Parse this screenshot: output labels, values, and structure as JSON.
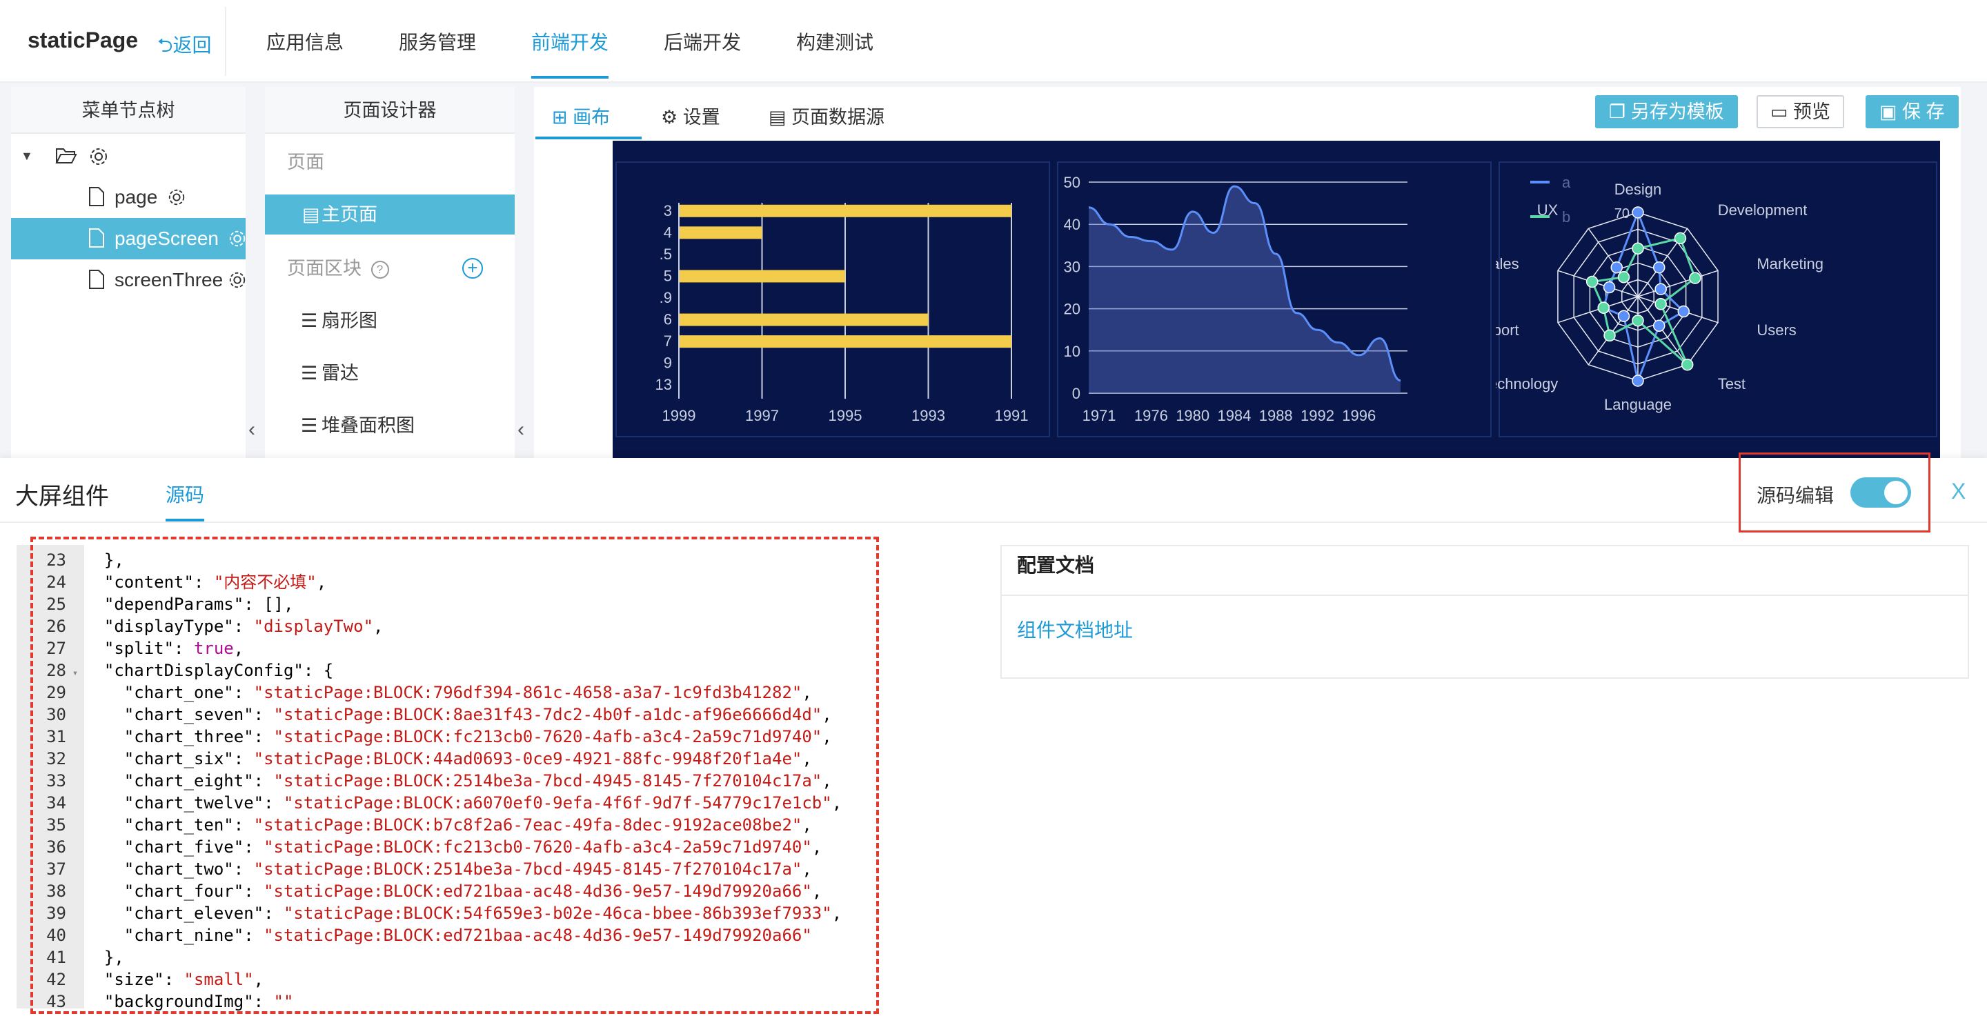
{
  "app": {
    "brand": "staticPage",
    "back_label": "返回"
  },
  "nav": {
    "tabs": [
      "应用信息",
      "服务管理",
      "前端开发",
      "后端开发",
      "构建测试"
    ],
    "active_index": 2
  },
  "menu_tree": {
    "title": "菜单节点树",
    "items": [
      {
        "label": "page"
      },
      {
        "label": "pageScreen",
        "selected": true
      },
      {
        "label": "screenThree"
      }
    ]
  },
  "designer": {
    "title": "页面设计器",
    "page_group": "页面",
    "main_page": "主页面",
    "blocks_group": "页面区块",
    "blocks": [
      "扇形图",
      "雷达",
      "堆叠面积图"
    ]
  },
  "canvas": {
    "tabs": [
      "画布",
      "设置",
      "页面数据源"
    ],
    "buttons": {
      "save_template": "另存为模板",
      "preview": "预览",
      "save": "保 存"
    }
  },
  "chart_data": [
    {
      "type": "bar",
      "orientation": "horizontal",
      "categories": [
        "3",
        "4",
        ".5",
        "5",
        ".9",
        "6",
        "7",
        "9",
        "13"
      ],
      "values": [
        1991.0,
        1997.0,
        null,
        1995.0,
        null,
        1993.0,
        1991.0,
        1999.0,
        null
      ],
      "x_ticks": [
        "1999",
        "1997",
        "1995",
        "1993",
        "1991"
      ],
      "color": "#f2cc4a"
    },
    {
      "type": "area",
      "x_ticks": [
        "1971",
        "1976",
        "1980",
        "1984",
        "1988",
        "1992",
        "1996"
      ],
      "y_ticks": [
        0,
        10,
        20,
        30,
        40,
        50
      ],
      "ylim": [
        0,
        50
      ],
      "x": [
        1970,
        1972,
        1974,
        1976,
        1978,
        1980,
        1982,
        1984,
        1986,
        1988,
        1990,
        1992,
        1994,
        1996,
        1998,
        2000
      ],
      "values": [
        44,
        40,
        37,
        36,
        34,
        43,
        38,
        49,
        45,
        33,
        19,
        15,
        12,
        9,
        13,
        3
      ],
      "color": "#5b8ff9"
    },
    {
      "type": "radar",
      "legend": [
        "a",
        "b"
      ],
      "axes": [
        "Design",
        "Development",
        "Marketing",
        "Users",
        "Test",
        "Language",
        "Technology",
        "Support",
        "Sales",
        "UX"
      ],
      "radial_tick": "70",
      "series": [
        {
          "name": "a",
          "values": [
            70,
            30,
            20,
            40,
            30,
            70,
            20,
            30,
            25,
            30
          ]
        },
        {
          "name": "b",
          "values": [
            40,
            60,
            50,
            20,
            70,
            20,
            40,
            30,
            40,
            20
          ]
        }
      ],
      "colors": [
        "#5b8ff9",
        "#5ad8a6"
      ]
    }
  ],
  "drawer": {
    "title": "大屏组件",
    "tab": "源码",
    "toggle_label": "源码编辑",
    "toggle_on": true,
    "close": "X"
  },
  "code": {
    "lines": [
      {
        "n": "23",
        "text": "  },",
        "fold": false
      },
      {
        "n": "24",
        "key": "\"content\"",
        "val": "\"内容不必填\"",
        "vtype": "s",
        "tail": ",",
        "indent": "  "
      },
      {
        "n": "25",
        "key": "\"dependParams\"",
        "val": "[]",
        "vtype": "p",
        "tail": ",",
        "indent": "  "
      },
      {
        "n": "26",
        "key": "\"displayType\"",
        "val": "\"displayTwo\"",
        "vtype": "s",
        "tail": ",",
        "indent": "  "
      },
      {
        "n": "27",
        "key": "\"split\"",
        "val": "true",
        "vtype": "b",
        "tail": ",",
        "indent": "  "
      },
      {
        "n": "28",
        "key": "\"chartDisplayConfig\"",
        "val": "{",
        "vtype": "p",
        "tail": "",
        "indent": "  ",
        "fold": true
      },
      {
        "n": "29",
        "key": "\"chart_one\"",
        "val": "\"staticPage:BLOCK:796df394-861c-4658-a3a7-1c9fd3b41282\"",
        "vtype": "s",
        "tail": ",",
        "indent": "    "
      },
      {
        "n": "30",
        "key": "\"chart_seven\"",
        "val": "\"staticPage:BLOCK:8ae31f43-7dc2-4b0f-a1dc-af96e6666d4d\"",
        "vtype": "s",
        "tail": ",",
        "indent": "    "
      },
      {
        "n": "31",
        "key": "\"chart_three\"",
        "val": "\"staticPage:BLOCK:fc213cb0-7620-4afb-a3c4-2a59c71d9740\"",
        "vtype": "s",
        "tail": ",",
        "indent": "    "
      },
      {
        "n": "32",
        "key": "\"chart_six\"",
        "val": "\"staticPage:BLOCK:44ad0693-0ce9-4921-88fc-9948f20f1a4e\"",
        "vtype": "s",
        "tail": ",",
        "indent": "    "
      },
      {
        "n": "33",
        "key": "\"chart_eight\"",
        "val": "\"staticPage:BLOCK:2514be3a-7bcd-4945-8145-7f270104c17a\"",
        "vtype": "s",
        "tail": ",",
        "indent": "    "
      },
      {
        "n": "34",
        "key": "\"chart_twelve\"",
        "val": "\"staticPage:BLOCK:a6070ef0-9efa-4f6f-9d7f-54779c17e1cb\"",
        "vtype": "s",
        "tail": ",",
        "indent": "    "
      },
      {
        "n": "35",
        "key": "\"chart_ten\"",
        "val": "\"staticPage:BLOCK:b7c8f2a6-7eac-49fa-8dec-9192ace08be2\"",
        "vtype": "s",
        "tail": ",",
        "indent": "    "
      },
      {
        "n": "36",
        "key": "\"chart_five\"",
        "val": "\"staticPage:BLOCK:fc213cb0-7620-4afb-a3c4-2a59c71d9740\"",
        "vtype": "s",
        "tail": ",",
        "indent": "    "
      },
      {
        "n": "37",
        "key": "\"chart_two\"",
        "val": "\"staticPage:BLOCK:2514be3a-7bcd-4945-8145-7f270104c17a\"",
        "vtype": "s",
        "tail": ",",
        "indent": "    "
      },
      {
        "n": "38",
        "key": "\"chart_four\"",
        "val": "\"staticPage:BLOCK:ed721baa-ac48-4d36-9e57-149d79920a66\"",
        "vtype": "s",
        "tail": ",",
        "indent": "    "
      },
      {
        "n": "39",
        "key": "\"chart_eleven\"",
        "val": "\"staticPage:BLOCK:54f659e3-b02e-46ca-bbee-86b393ef7933\"",
        "vtype": "s",
        "tail": ",",
        "indent": "    "
      },
      {
        "n": "40",
        "key": "\"chart_nine\"",
        "val": "\"staticPage:BLOCK:ed721baa-ac48-4d36-9e57-149d79920a66\"",
        "vtype": "s",
        "tail": "",
        "indent": "    "
      },
      {
        "n": "41",
        "text": "  },",
        "fold": false
      },
      {
        "n": "42",
        "key": "\"size\"",
        "val": "\"small\"",
        "vtype": "s",
        "tail": ",",
        "indent": "  "
      },
      {
        "n": "43",
        "key": "\"backgroundImg\"",
        "val": "\"\"",
        "vtype": "s",
        "tail": "",
        "indent": "  "
      }
    ]
  },
  "docs": {
    "title": "配置文档",
    "link": "组件文档地址"
  },
  "colors": {
    "accent": "#1d9ad6",
    "selected_bg": "#53b9d8",
    "screen_bg": "#071548",
    "annotation_red": "#e03a2f"
  }
}
